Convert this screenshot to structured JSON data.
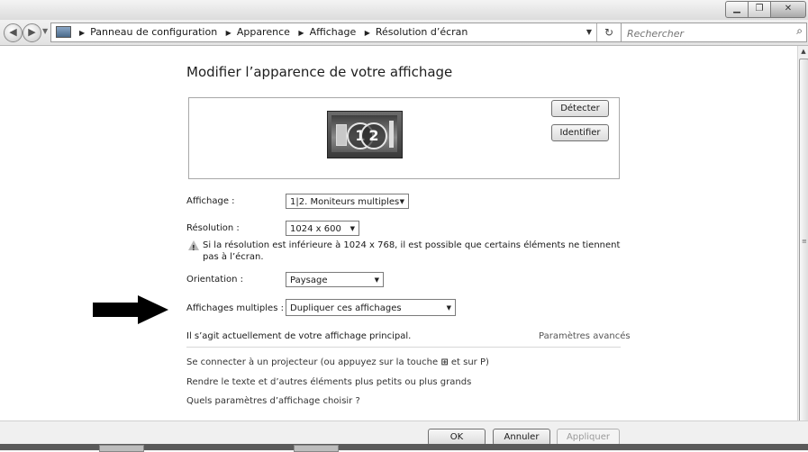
{
  "breadcrumbs": [
    "Panneau de configuration",
    "Apparence",
    "Affichage",
    "Résolution d’écran"
  ],
  "search": {
    "placeholder": "Rechercher"
  },
  "icons": {
    "back": "back-arrow-icon",
    "forward": "forward-arrow-icon",
    "refresh": "refresh-icon",
    "search": "search-icon",
    "warning": "warning-icon",
    "arrow": "right-arrow-icon",
    "monitor": "monitor-icon"
  },
  "page": {
    "title": "Modifier l’apparence de votre affichage"
  },
  "monitor": {
    "label1": "1",
    "label2": "2"
  },
  "buttons": {
    "detect": "Détecter",
    "identify": "Identifier",
    "ok": "OK",
    "cancel": "Annuler",
    "apply": "Appliquer"
  },
  "fields": {
    "display_label": "Affichage :",
    "display_value": "1|2. Moniteurs multiples",
    "resolution_label": "Résolution :",
    "resolution_value": "1024 x 600",
    "orientation_label": "Orientation :",
    "orientation_value": "Paysage",
    "multiple_label": "Affichages multiples :",
    "multiple_value": "Dupliquer ces affichages"
  },
  "warning": "Si la résolution est inférieure à 1024 x 768, il est possible que certains éléments ne tiennent pas à l’écran.",
  "primary_text": "Il s’agit actuellement de votre affichage principal.",
  "advanced_link": "Paramètres avancés",
  "links": {
    "projector_pre": "Se connecter à un projecteur",
    "projector_mid": " (ou appuyez sur la touche ",
    "projector_post": " et sur P)",
    "text_size": "Rendre le texte et d’autres éléments plus petits ou plus grands",
    "which_settings": "Quels paramètres d’affichage choisir ?"
  }
}
